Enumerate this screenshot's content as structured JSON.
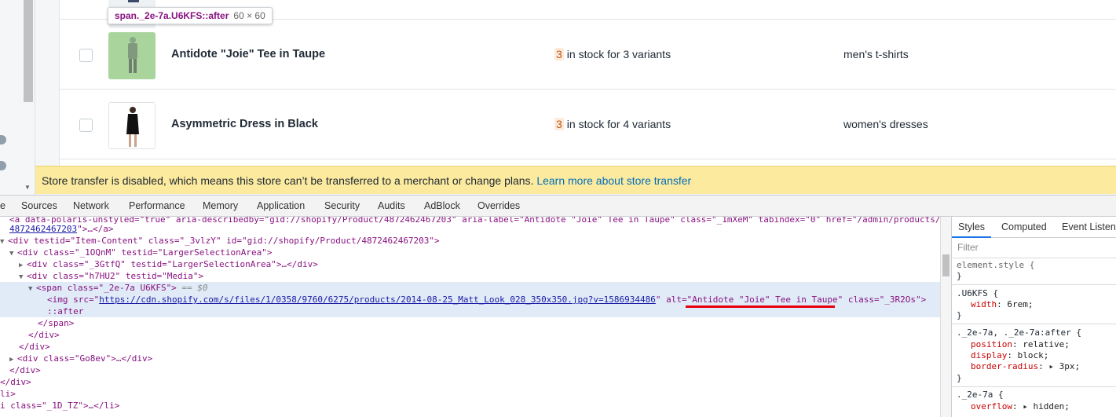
{
  "tooltip": {
    "selector": "span._2e-7a.U6KFS::after",
    "size": "60 × 60"
  },
  "products": [
    {
      "name": "Antidote \"Joie\" Tee in Taupe",
      "stock_count": "3",
      "stock_text": "in stock for 3 variants",
      "type": "men's t-shirts"
    },
    {
      "name": "Asymmetric Dress in Black",
      "stock_count": "3",
      "stock_text": "in stock for 4 variants",
      "type": "women's dresses"
    }
  ],
  "banner": {
    "text": "Store transfer is disabled, which means this store can’t be transferred to a merchant or change plans.",
    "link": "Learn more about store transfer"
  },
  "devtools": {
    "tabs": [
      "e",
      "Sources",
      "Network",
      "Performance",
      "Memory",
      "Application",
      "Security",
      "Audits",
      "AdBlock",
      "Overrides"
    ],
    "styles_tabs": [
      "Styles",
      "Computed",
      "Event Listene"
    ],
    "filter_placeholder": "Filter",
    "dom": {
      "l0": "<a data-polaris-unstyled=\"true\" aria-describedby=\"gid://shopify/Product/4872462467203\" aria-label=\"Antidote \"Joie\" Tee in Taupe\" class=\"_1mXeM\" tabindex=\"0\" href=\"/admin/products/",
      "l1_link": "4872462467203",
      "l1_end": "\">…</a>",
      "l2": "<div testid=\"Item-Content\" class=\"_3vlzY\" id=\"gid://shopify/Product/4872462467203\">",
      "l3": "<div class=\"_1OQnM\" testid=\"LargerSelectionArea\">",
      "l4": "<div class=\"_3GtfQ\" testid=\"LargerSelectionArea\">…</div>",
      "l5": "<div class=\"h7HU2\" testid=\"Media\">",
      "l6": "<span class=\"_2e-7a U6KFS\">",
      "l6_eq": " == $0",
      "l7_pre": "<img src=\"",
      "l7_link": "https://cdn.shopify.com/s/files/1/0358/9760/6275/products/2014-08-25_Matt_Look_028_350x350.jpg?v=1586934486",
      "l7_alt": "\" alt=\"Antidote \"Joie\" Tee in Taupe\" class=\"_3R2Os\">",
      "l8": "::after",
      "l9": "</span>",
      "l10": "</div>",
      "l11": "</div>",
      "l12": "<div class=\"Go8ev\">…</div>",
      "l13": "</div>",
      "l14": "</div>",
      "l15": "li>",
      "l16": "i class=\"_1D_TZ\">…</li>"
    },
    "styles": {
      "element_style": "element.style {",
      "r1_sel": ".U6KFS {",
      "r1_prop": "width",
      "r1_val": "6rem;",
      "r2_sel": "._2e-7a, ._2e-7a:after {",
      "r2_p1": "position",
      "r2_v1": "relative;",
      "r2_p2": "display",
      "r2_v2": "block;",
      "r2_p3": "border-radius",
      "r2_v3": "3px;",
      "r3_sel": "._2e-7a {",
      "r3_p1": "overflow",
      "r3_v1": "hidden;",
      "close": "}"
    }
  }
}
